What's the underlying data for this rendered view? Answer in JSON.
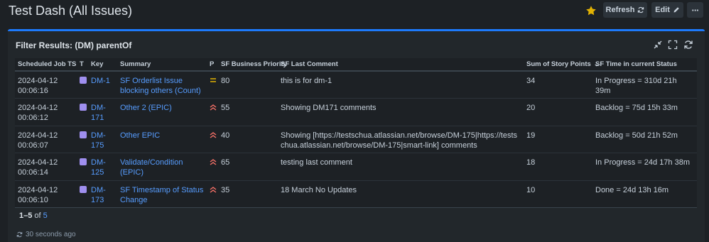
{
  "header": {
    "title": "Test Dash (All Issues)",
    "refresh_label": "Refresh",
    "edit_label": "Edit",
    "more_label": "···"
  },
  "colors": {
    "accent": "#1d7afc",
    "link": "#579dff",
    "star": "#e2b203",
    "epic": "#9f8fef",
    "priority_high": "#f87168",
    "priority_medium": "#e2b203"
  },
  "gadget": {
    "title": "Filter Results: (DM) parentOf",
    "columns": [
      "Scheduled Job TS",
      "T",
      "Key",
      "Summary",
      "P",
      "SF Business Priority",
      "SF Last Comment",
      "Sum of Story Points",
      "SF Time in current Status"
    ],
    "rows": [
      {
        "ts1": "2024-04-12",
        "ts2": "00:06:16",
        "type_icon": "epic-icon",
        "key": "DM-1",
        "summary": "SF Orderlist Issue blocking others (Count)",
        "priority_icon": "priority-medium-icon",
        "bp": "80",
        "comment": "this is for dm-1",
        "points": "34",
        "status_time": "In Progress = 310d 21h 39m"
      },
      {
        "ts1": "2024-04-12",
        "ts2": "00:06:12",
        "type_icon": "epic-icon",
        "key": "DM-171",
        "summary": "Other 2 (EPIC)",
        "priority_icon": "priority-high-icon",
        "bp": "55",
        "comment": "Showing DM171 comments",
        "points": "20",
        "status_time": "Backlog = 75d 15h 33m"
      },
      {
        "ts1": "2024-04-12",
        "ts2": "00:06:07",
        "type_icon": "epic-icon",
        "key": "DM-175",
        "summary": "Other EPIC",
        "priority_icon": "priority-high-icon",
        "bp": "40",
        "comment": "Showing [https://testschua.atlassian.net/browse/DM-175|https://testschua.atlassian.net/browse/DM-175|smart-link] comments",
        "points": "19",
        "status_time": "Backlog = 50d 21h 52m"
      },
      {
        "ts1": "2024-04-12",
        "ts2": "00:06:14",
        "type_icon": "epic-icon",
        "key": "DM-125",
        "summary": "Validate/Condition (EPIC)",
        "priority_icon": "priority-high-icon",
        "bp": "65",
        "comment": "testing last comment",
        "points": "18",
        "status_time": "In Progress = 24d 17h 38m"
      },
      {
        "ts1": "2024-04-12",
        "ts2": "00:06:10",
        "type_icon": "epic-icon",
        "key": "DM-173",
        "summary": "SF Timestamp of Status Change",
        "priority_icon": "priority-high-icon",
        "bp": "35",
        "comment": "18 March No Updates",
        "points": "10",
        "status_time": "Done = 24d 13h 16m"
      }
    ],
    "count_range": "1–5",
    "count_of": "of",
    "count_total": "5",
    "updated": "30 seconds ago"
  }
}
